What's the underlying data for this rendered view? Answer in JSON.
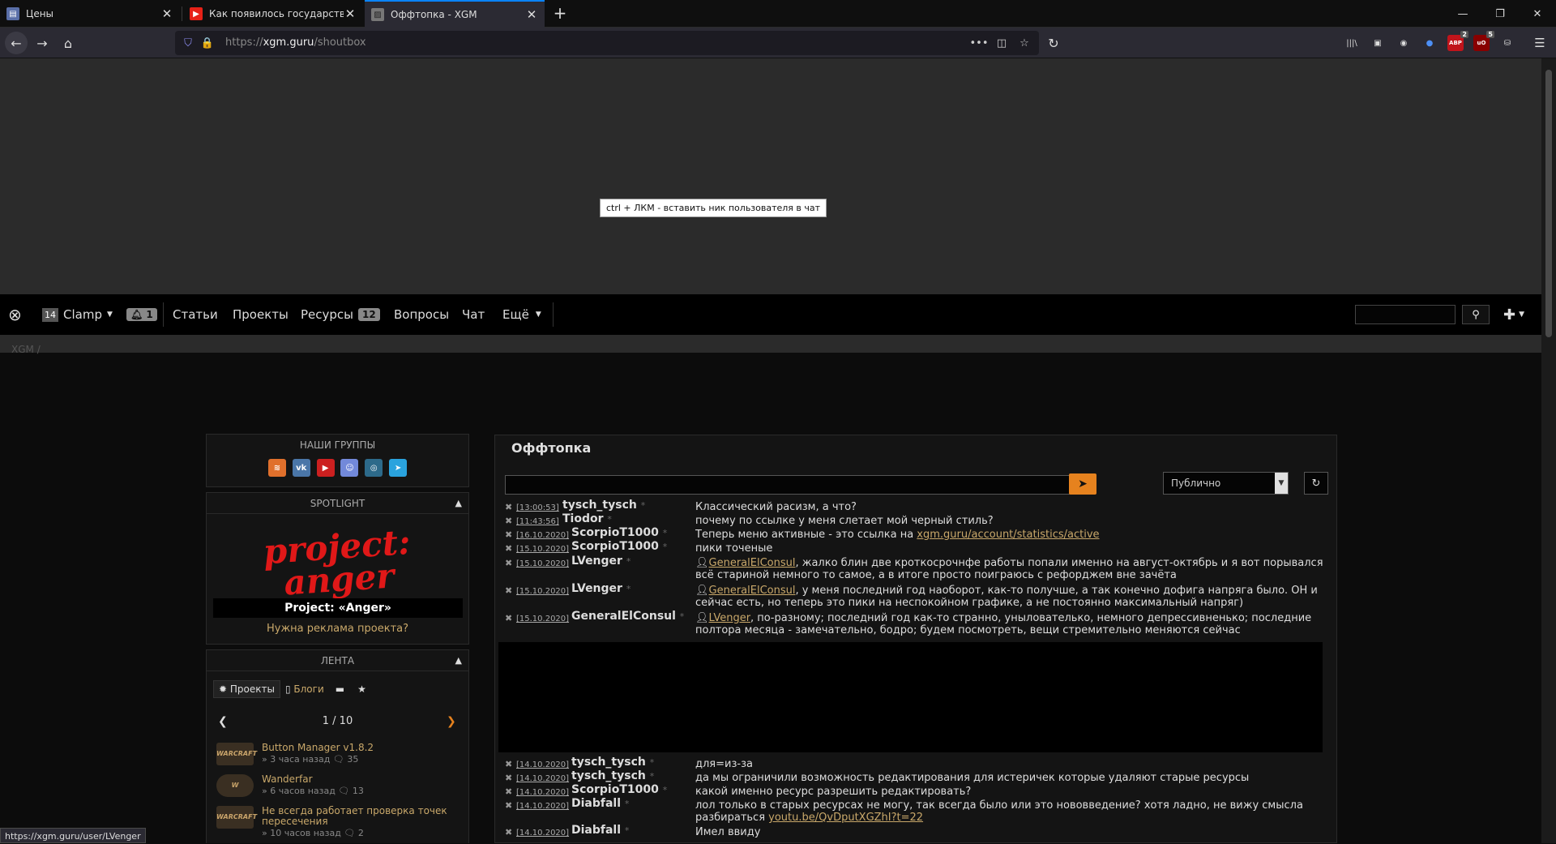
{
  "browser": {
    "tabs": [
      {
        "label": "Цены",
        "icon": "notes-icon"
      },
      {
        "label": "Как появилось государство И",
        "icon": "youtube-icon"
      },
      {
        "label": "Оффтопка - XGM",
        "icon": "site-icon"
      }
    ],
    "url_scheme": "https://",
    "url_domain": "xgm.guru",
    "url_path": "/shoutbox",
    "ext_badges": {
      "abp": "2",
      "ubo": "5"
    },
    "status_url": "https://xgm.guru/user/LVenger"
  },
  "tooltip": "ctrl + ЛКМ - вставить ник пользователя в чат",
  "sitenav": {
    "user_level": "14",
    "username": "Clamp",
    "notif_count": "1",
    "items": [
      "Статьи",
      "Проекты",
      "Ресурсы",
      "Вопросы",
      "Чат",
      "Ещё"
    ],
    "resources_badge": "12"
  },
  "breadcrumb": "XGM",
  "sidebar": {
    "groups_title": "НАШИ ГРУППЫ",
    "spotlight_title": "SPOTLIGHT",
    "spotlight_logo": "project: anger",
    "spotlight_caption": "Project: «Anger»",
    "ad_link": "Нужна реклама проекта?",
    "feed_title": "ЛЕНТА",
    "feed_tabs": [
      "Проекты",
      "Блоги"
    ],
    "pager": "1 / 10",
    "feed_items": [
      {
        "title": "Button Manager v1.8.2",
        "meta": "» 3 часа назад",
        "count": "35",
        "thumb": "WARCRAFT"
      },
      {
        "title": "Wanderfar",
        "meta": "» 6 часов назад",
        "count": "13",
        "thumb": "W"
      },
      {
        "title": "Не всегда работает проверка точек пересечения",
        "meta": "» 10 часов назад",
        "count": "2",
        "thumb": "WARCRAFT"
      }
    ]
  },
  "main": {
    "title": "Оффтопка",
    "visibility": "Публично",
    "messages": [
      {
        "ts": "[13:00:53]",
        "nick": "tysch_tysch",
        "text": "Классический расизм, а что?"
      },
      {
        "ts": "[11:43:56]",
        "nick": "Tiodor",
        "text": "почему по ссылке у меня слетает мой черный стиль?"
      },
      {
        "ts": "[16.10.2020]",
        "nick": "ScorpioT1000",
        "text": "Теперь меню активные - это ссылка на ",
        "link": "xgm.guru/account/statistics/active"
      },
      {
        "ts": "[15.10.2020]",
        "nick": "ScorpioT1000",
        "text": "пики точеные"
      },
      {
        "ts": "[15.10.2020]",
        "nick": "LVenger",
        "mention": "GeneralElConsul",
        "text": ", жалко блин две кроткосрочнфе работы попали именно на август-октябрь и я вот порывался всё стариной немного то самое, а в итоге просто поиграюсь с рефорджем вне зачёта"
      },
      {
        "ts": "[15.10.2020]",
        "nick": "LVenger",
        "mention": "GeneralElConsul",
        "text": ", у меня последний год наоборот, как-то получше, а так конечно дофига напряга было. ОН и сейчас есть, но теперь это пики на неспокойном графике, а не постоянно максимальный напряг)"
      },
      {
        "ts": "[15.10.2020]",
        "nick": "GeneralElConsul",
        "mention": "LVenger",
        "text": ", по-разному; последний год как-то странно, унылователько, немного депрессивненько; последние полтора месяца - замечательно, бодро; будем посмотреть, вещи стремительно меняются сейчас"
      },
      {
        "ts": "[14.10.2020]",
        "nick": "tysch_tysch",
        "text": "для=из-за"
      },
      {
        "ts": "[14.10.2020]",
        "nick": "tysch_tysch",
        "text": "да мы ограничили возможность редактирования для истеричек которые удаляют старые ресурсы"
      },
      {
        "ts": "[14.10.2020]",
        "nick": "ScorpioT1000",
        "text": "какой именно ресурс разрешить редактировать?"
      },
      {
        "ts": "[14.10.2020]",
        "nick": "Diabfall",
        "text": "лол только в старых ресурсах не могу, так всегда было или это нововведение? хотя ладно, не вижу смысла разбираться ",
        "link": "youtu.be/QvDputXGZhI?t=22"
      },
      {
        "ts": "[14.10.2020]",
        "nick": "Diabfall",
        "text": "Имел ввиду"
      }
    ]
  }
}
